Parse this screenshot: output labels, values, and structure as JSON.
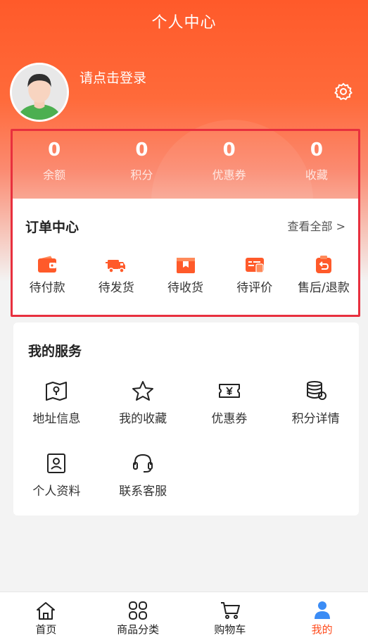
{
  "header": {
    "title": "个人中心",
    "login_text": "请点击登录"
  },
  "stats": [
    {
      "value": "0",
      "label": "余额"
    },
    {
      "value": "0",
      "label": "积分"
    },
    {
      "value": "0",
      "label": "优惠券"
    },
    {
      "value": "0",
      "label": "收藏"
    }
  ],
  "orders": {
    "title": "订单中心",
    "view_all": "查看全部 >",
    "items": [
      {
        "label": "待付款",
        "icon": "wallet-icon"
      },
      {
        "label": "待发货",
        "icon": "truck-icon"
      },
      {
        "label": "待收货",
        "icon": "package-icon"
      },
      {
        "label": "待评价",
        "icon": "review-icon"
      },
      {
        "label": "售后/退款",
        "icon": "refund-icon"
      }
    ]
  },
  "services": {
    "title": "我的服务",
    "items": [
      {
        "label": "地址信息",
        "icon": "map-icon"
      },
      {
        "label": "我的收藏",
        "icon": "star-icon"
      },
      {
        "label": "优惠券",
        "icon": "coupon-icon"
      },
      {
        "label": "积分详情",
        "icon": "coins-icon"
      },
      {
        "label": "个人资料",
        "icon": "profile-icon"
      },
      {
        "label": "联系客服",
        "icon": "headset-icon"
      }
    ]
  },
  "tabbar": {
    "items": [
      {
        "label": "首页",
        "icon": "home-icon"
      },
      {
        "label": "商品分类",
        "icon": "grid-icon"
      },
      {
        "label": "购物车",
        "icon": "cart-icon"
      },
      {
        "label": "我的",
        "icon": "user-icon",
        "active": true
      }
    ]
  },
  "colors": {
    "accent": "#ff4d1f",
    "hero_top": "#ff5a2a",
    "highlight": "#e8303e",
    "order_icon": "#ff5a2a",
    "tab_active": "#3b8cf5"
  }
}
